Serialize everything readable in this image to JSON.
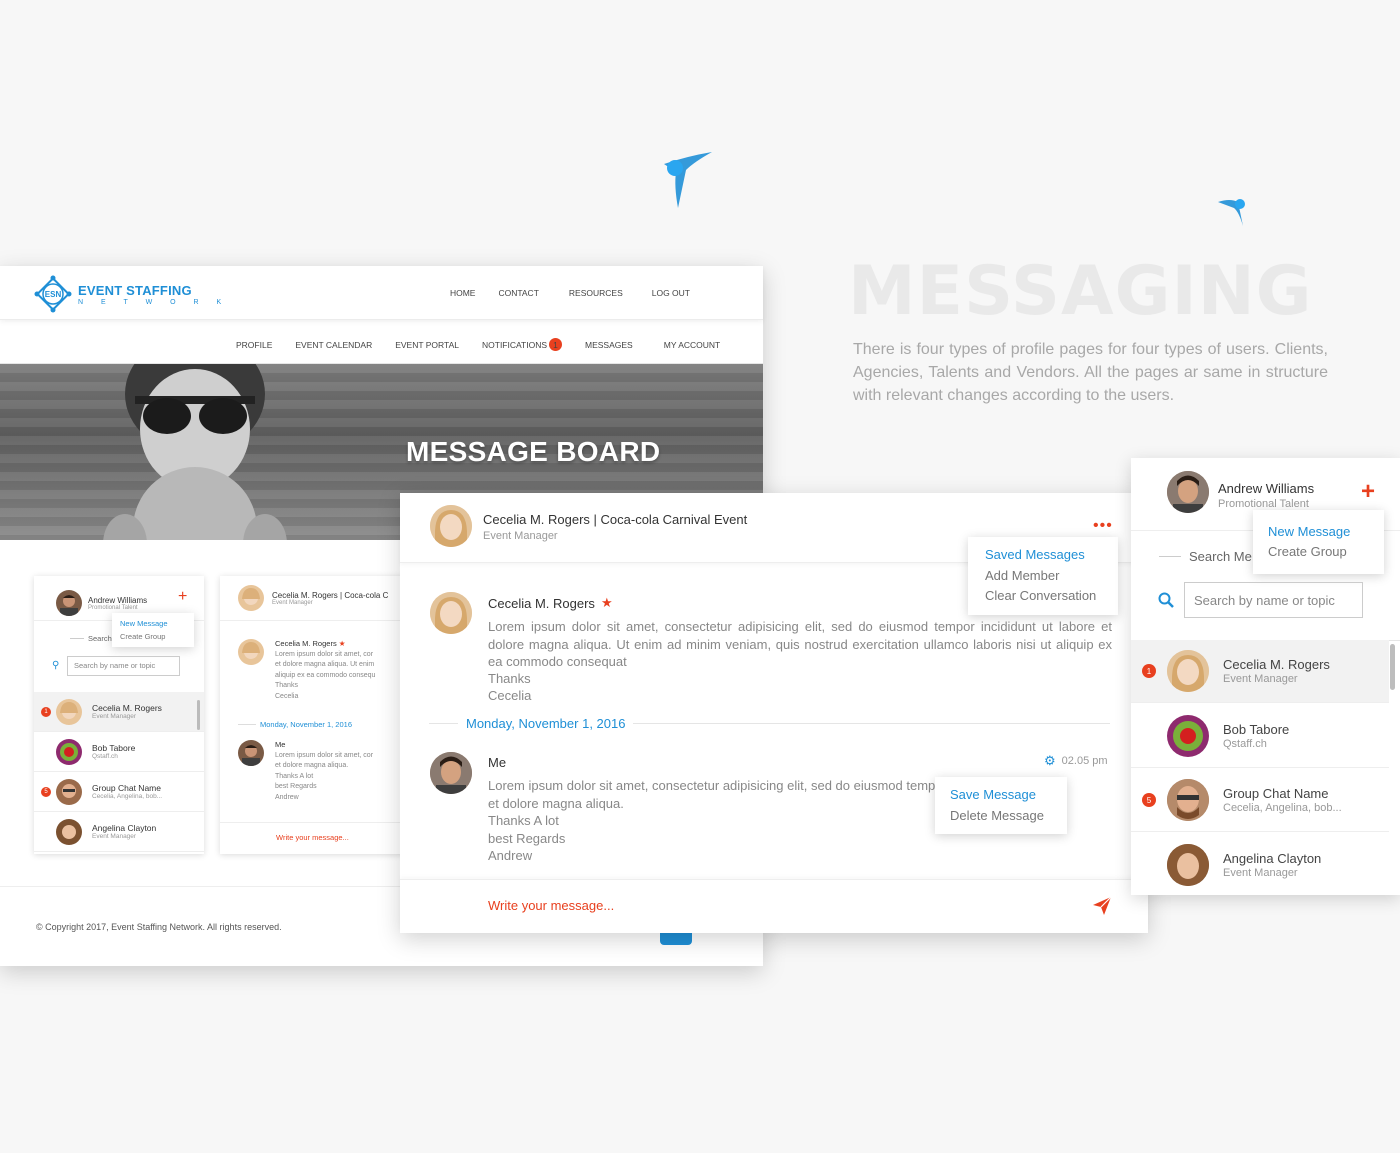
{
  "brand": {
    "name": "EVENT STAFFING",
    "sub": "N E T W O R K",
    "mark": "ESN"
  },
  "topnav": [
    "HOME",
    "CONTACT",
    "RESOURCES",
    "LOG OUT"
  ],
  "subnav": {
    "items": [
      "PROFILE",
      "EVENT CALENDAR",
      "EVENT PORTAL",
      "NOTIFICATIONS",
      "MESSAGES",
      "MY ACCOUNT"
    ],
    "notifications_count": "1",
    "active": "MESSAGES"
  },
  "hero": {
    "title": "MESSAGE BOARD"
  },
  "footer": {
    "copyright": "© Copyright 2017, Event Staffing Network. All rights reserved."
  },
  "headline": {
    "title": "MESSAGING",
    "description": "There is four types of profile pages for four types of users. Clients, Agencies, Talents and Vendors. All the pages ar same in structure with relevant changes according to the users."
  },
  "user": {
    "name": "Andrew Williams",
    "role": "Promotional Talent"
  },
  "new_menu": {
    "new_message": "New Message",
    "create_group": "Create Group"
  },
  "search": {
    "label": "Search Me",
    "placeholder": "Search by name or topic"
  },
  "contacts": [
    {
      "name": "Cecelia M. Rogers",
      "sub": "Event Manager",
      "badge": "1"
    },
    {
      "name": "Bob Tabore",
      "sub": "Qstaff.ch",
      "badge": ""
    },
    {
      "name": "Group Chat Name",
      "sub": "Cecelia, Angelina, bob...",
      "badge": "5"
    },
    {
      "name": "Angelina Clayton",
      "sub": "Event Manager",
      "badge": ""
    }
  ],
  "chat": {
    "header_title": "Cecelia M. Rogers | Coca-cola Carnival Event",
    "header_role": "Event Manager",
    "options": [
      "Saved Messages",
      "Add Member",
      "Clear Conversation"
    ],
    "msg1": {
      "author": "Cecelia M. Rogers",
      "body": "Lorem ipsum dolor sit amet, consectetur adipisicing elit, sed do eiusmod tempor incididunt ut labore et dolore magna aliqua. Ut enim ad minim veniam, quis nostrud exercitation ullamco laboris nisi ut aliquip ex ea commodo consequat",
      "line2": "Thanks",
      "line3": "Cecelia"
    },
    "date_divider": "Monday, November 1, 2016",
    "msg2": {
      "author": "Me",
      "time": "02.05 pm",
      "body1": "Lorem ipsum dolor sit amet, consectetur adipisicing elit, sed do eiusmod tempor incididunt ut labore",
      "body2": "et dolore magna aliqua.",
      "line2": "Thanks A lot",
      "line3": "best Regards",
      "line4": "Andrew"
    },
    "message_menu": [
      "Save Message",
      "Delete Message"
    ],
    "composer_placeholder": "Write your message..."
  },
  "small_chat": {
    "header_title": "Cecelia M. Rogers | Coca-cola C",
    "msg1_body": "Lorem ipsum dolor sit amet, cor",
    "msg1_body2": "et dolore magna aliqua. Ut enim",
    "msg1_body3": "aliquip ex ea commodo consequ",
    "msg2_body": "Lorem ipsum dolor sit amet, cor",
    "msg2_body2": "et dolore magna aliqua."
  },
  "colors": {
    "accent": "#1f8fd6",
    "orange": "#e8401f",
    "headline": "#e9e9e9"
  }
}
